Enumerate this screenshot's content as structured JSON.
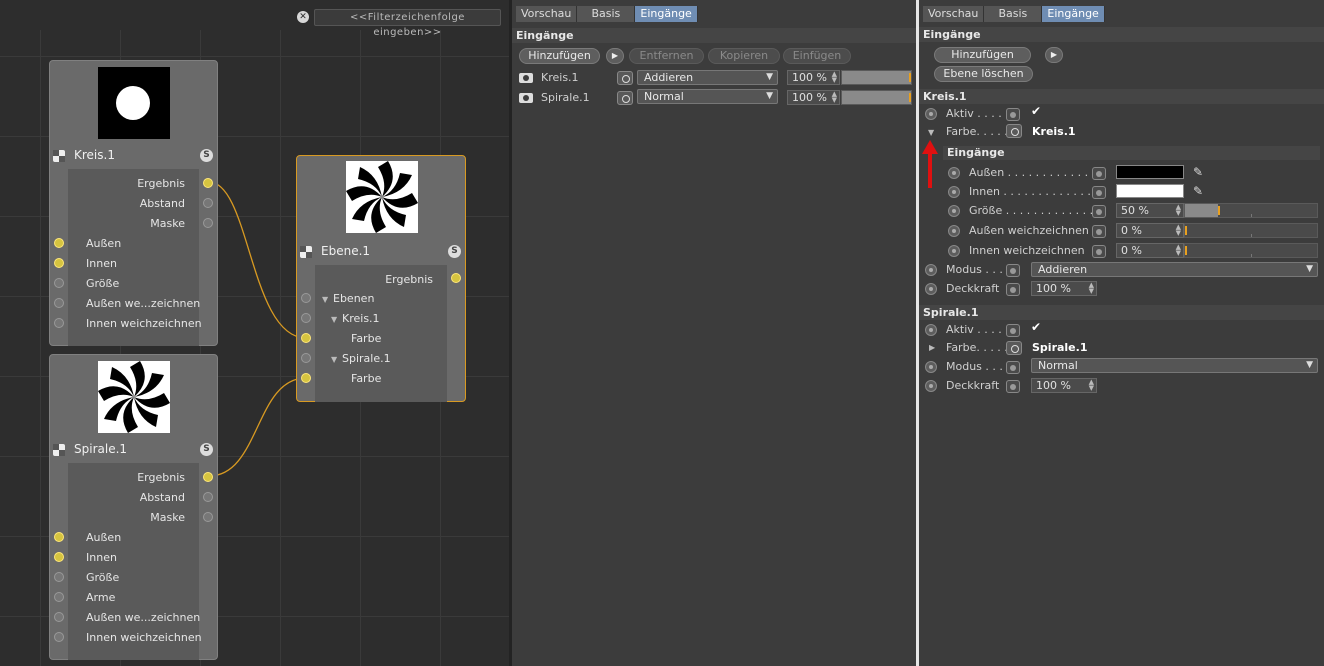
{
  "node_editor": {
    "filter_placeholder": "<<Filterzeichenfolge eingeben>>",
    "nodes": [
      {
        "name": "Kreis.1",
        "badge": "S",
        "ports_out": [
          "Ergebnis",
          "Abstand",
          "Maske"
        ],
        "ports_in": [
          "Außen",
          "Innen",
          "Größe",
          "Außen we...zeichnen",
          "Innen weichzeichnen"
        ]
      },
      {
        "name": "Spirale.1",
        "badge": "S",
        "ports_out": [
          "Ergebnis",
          "Abstand",
          "Maske"
        ],
        "ports_in": [
          "Außen",
          "Innen",
          "Größe",
          "Arme",
          "Außen we...zeichnen",
          "Innen weichzeichnen"
        ]
      },
      {
        "name": "Ebene.1",
        "badge": "S",
        "ports_out": [
          "Ergebnis"
        ],
        "tree": [
          "Ebenen",
          "Kreis.1",
          "Farbe",
          "Spirale.1",
          "Farbe"
        ]
      }
    ]
  },
  "mid_panel": {
    "tabs": [
      "Vorschau",
      "Basis",
      "Eingänge"
    ],
    "active_tab": "Eingänge",
    "section": "Eingänge",
    "buttons": [
      "Hinzufügen",
      "Entfernen",
      "Kopieren",
      "Einfügen"
    ],
    "layers": [
      {
        "name": "Kreis.1",
        "mode": "Addieren",
        "opacity": "100 %",
        "opacity_fraction": 1.0
      },
      {
        "name": "Spirale.1",
        "mode": "Normal",
        "opacity": "100 %",
        "opacity_fraction": 1.0
      }
    ]
  },
  "right_panel": {
    "tabs": [
      "Vorschau",
      "Basis",
      "Eingänge"
    ],
    "active_tab": "Eingänge",
    "section": "Eingänge",
    "buttons": [
      "Hinzufügen",
      "Ebene löschen"
    ],
    "kreis": {
      "header": "Kreis.1",
      "aktiv_label": "Aktiv . . . . .",
      "farbe_label": "Farbe. . . . .",
      "farbe_value": "Kreis.1",
      "sub_header": "Eingänge",
      "aussen_label": "Außen . . . . . . . . . . . . . .",
      "innen_label": "Innen . . . . . . . . . . . . . .",
      "groesse_label": "Größe . . . . . . . . . . . . . .",
      "groesse_value": "50 %",
      "groesse_fraction": 0.5,
      "aussen_weich_label": "Außen weichzeichnen",
      "aussen_weich_value": "0 %",
      "innen_weich_label": "Innen weichzeichnen",
      "innen_weich_value": "0 %",
      "modus_label": "Modus . . .",
      "modus_value": "Addieren",
      "deckkraft_label": "Deckkraft",
      "deckkraft_value": "100 %",
      "colors": {
        "aussen": "#000000",
        "innen": "#ffffff"
      }
    },
    "spirale": {
      "header": "Spirale.1",
      "aktiv_label": "Aktiv . . . . .",
      "farbe_label": "Farbe. . . . .",
      "farbe_value": "Spirale.1",
      "modus_label": "Modus . . .",
      "modus_value": "Normal",
      "deckkraft_label": "Deckkraft",
      "deckkraft_value": "100 %"
    }
  },
  "colors": {
    "accent": "#d89a22",
    "tab_active": "#6f8db3",
    "port_yellow": "#d6c440",
    "annotation_arrow": "#e01010"
  }
}
